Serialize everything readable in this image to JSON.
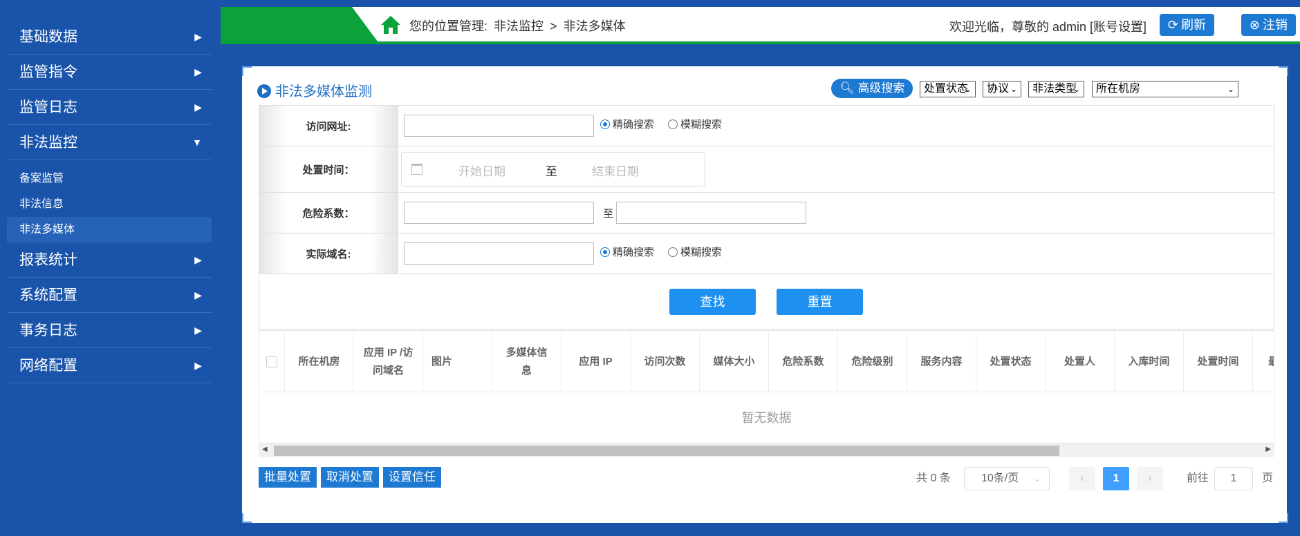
{
  "sidebar": {
    "items": [
      {
        "label": "基础数据"
      },
      {
        "label": "监管指令"
      },
      {
        "label": "监管日志"
      },
      {
        "label": "非法监控"
      },
      {
        "label": "报表统计"
      },
      {
        "label": "系统配置"
      },
      {
        "label": "事务日志"
      },
      {
        "label": "网络配置"
      }
    ],
    "submenu": [
      {
        "label": "备案监管"
      },
      {
        "label": "非法信息"
      },
      {
        "label": "非法多媒体"
      }
    ]
  },
  "topbar": {
    "location_label": "您的位置管理:",
    "crumb1": "非法监控",
    "separator": ">",
    "crumb2": "非法多媒体",
    "welcome": "欢迎光临，尊敬的 admin [账号设置]",
    "refresh": "刷新",
    "logout": "注销"
  },
  "panel": {
    "title": "非法多媒体监测",
    "adv_search": "高级搜索",
    "filters": {
      "status": "处置状态",
      "protocol": "协议",
      "illegal_type": "非法类型",
      "room": "所在机房"
    }
  },
  "form": {
    "url_label": "访问网址:",
    "exact": "精确搜索",
    "fuzzy": "模糊搜索",
    "time_label": "处置时间：",
    "start_date": "开始日期",
    "to": "至",
    "end_date": "结束日期",
    "risk_label": "危险系数：",
    "risk_to": "至",
    "domain_label": "实际域名:",
    "search_btn": "查找",
    "reset_btn": "重置"
  },
  "table": {
    "headers": [
      "所在机房",
      "应用 IP /访问域名",
      "图片",
      "多媒体信息",
      "应用 IP",
      "访问次数",
      "媒体大小",
      "危险系数",
      "危险级别",
      "服务内容",
      "处置状态",
      "处置人",
      "入库时间",
      "处置时间",
      "最"
    ],
    "empty": "暂无数据"
  },
  "footer": {
    "batch": "批量处置",
    "cancel": "取消处置",
    "trust": "设置信任",
    "total": "共 0 条",
    "page_size": "10条/页",
    "prev": "‹",
    "current_page": "1",
    "next": "›",
    "goto": "前往",
    "goto_value": "1",
    "page_unit": "页"
  },
  "colors": {
    "background": "#1a54aa",
    "accent": "#1e79d2",
    "green": "#0ba23a"
  }
}
